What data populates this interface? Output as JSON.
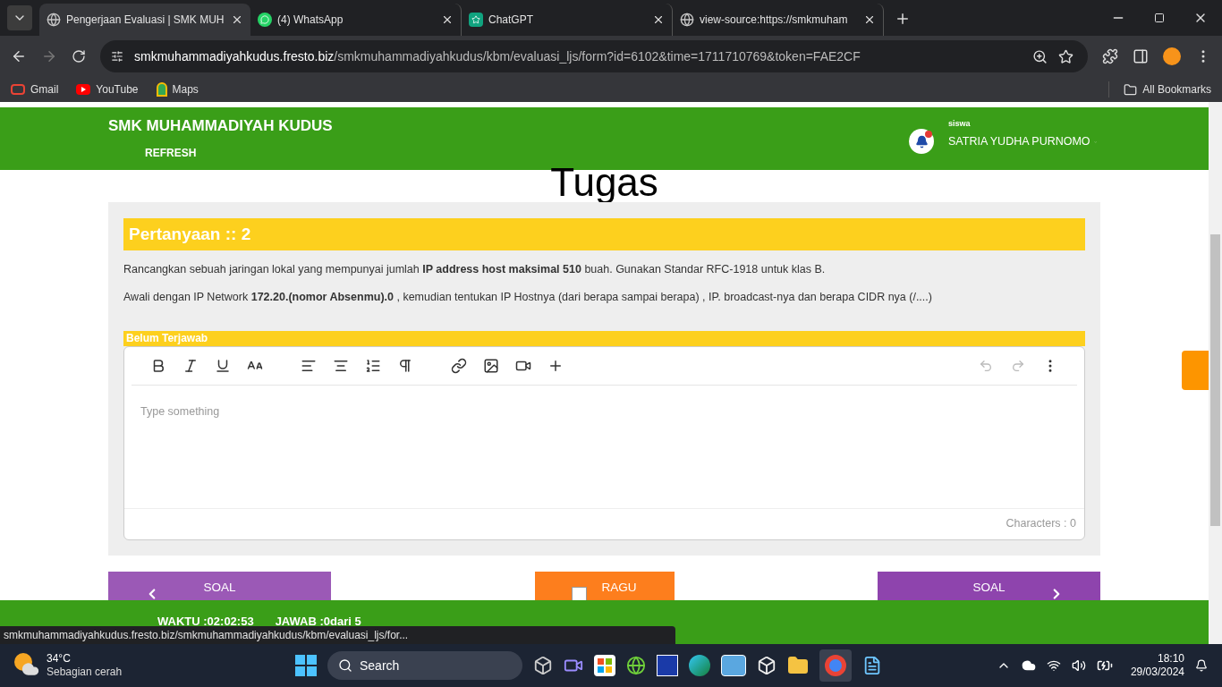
{
  "browser": {
    "tabs": [
      {
        "title": "Pengerjaan Evaluasi | SMK MUH",
        "selected": true,
        "kind": "globe"
      },
      {
        "title": "(4) WhatsApp",
        "selected": false,
        "kind": "whatsapp"
      },
      {
        "title": "ChatGPT",
        "selected": false,
        "kind": "chatgpt"
      },
      {
        "title": "view-source:https://smkmuham",
        "selected": false,
        "kind": "globe"
      }
    ],
    "url_host": "smkmuhammadiyahkudus.fresto.biz",
    "url_path": "/smkmuhammadiyahkudus/kbm/evaluasi_ljs/form?id=6102&time=1711710769&token=FAE2CF",
    "bookmarks": [
      {
        "label": "Gmail",
        "kind": "gmail"
      },
      {
        "label": "YouTube",
        "kind": "youtube"
      },
      {
        "label": "Maps",
        "kind": "maps"
      }
    ],
    "all_bookmarks": "All Bookmarks"
  },
  "page": {
    "brand": "SMK MUHAMMADIYAH KUDUS",
    "refresh": "REFRESH",
    "user_role": "siswa",
    "user_name": "SATRIA YUDHA PURNOMO",
    "heading": "Tugas",
    "question_title": "Pertanyaan :: 2",
    "paragraphs": [
      "Rancangkan sebuah jaringan lokal yang mempunyai jumlah **IP address host maksimal 510** buah. Gunakan Standar RFC-1918 untuk klas B.",
      "Awali dengan IP Network  **172.20.(nomor Absenmu).0** , kemudian tentukan IP Hostnya (dari berapa sampai berapa) , IP. broadcast-nya dan berapa CIDR nya (/....)"
    ],
    "answer_status": "Belum Terjawab",
    "editor": {
      "placeholder": "Type something",
      "char_count": "Characters : 0"
    },
    "prev_button": "SOAL",
    "ragu": {
      "label": "RAGU",
      "checked": false
    },
    "next_button": "SOAL",
    "timer": "WAKTU :02:02:53",
    "answered": "JAWAB :0dari 5"
  },
  "status_url": "smkmuhammadiyahkudus.fresto.biz/smkmuhammadiyahkudus/kbm/evaluasi_ljs/for...",
  "taskbar": {
    "temperature": "34°C",
    "weather": "Sebagian cerah",
    "search": "Search",
    "time": "18:10",
    "date": "29/03/2024"
  }
}
